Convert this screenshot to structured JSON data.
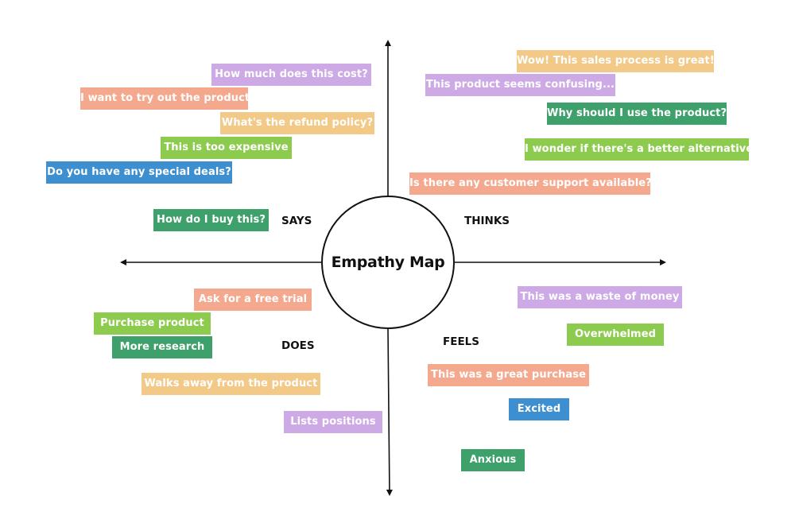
{
  "title": "Empathy Map",
  "colors": {
    "purple": "#CDA9E6",
    "salmon": "#F4A98F",
    "orange": "#F2C987",
    "green": "#8DCB4F",
    "dark_green": "#3EA06B",
    "blue": "#3D8FCF",
    "line": "#111111"
  },
  "quadrants": {
    "says": {
      "label": "SAYS",
      "notes": [
        {
          "text": "How much does this cost?",
          "color": "purple"
        },
        {
          "text": "I want to try out the product",
          "color": "salmon"
        },
        {
          "text": "What's the refund policy?",
          "color": "orange"
        },
        {
          "text": "This is too expensive",
          "color": "green"
        },
        {
          "text": "Do you have any special deals?",
          "color": "blue"
        },
        {
          "text": "How do I buy this?",
          "color": "dark_green"
        }
      ]
    },
    "thinks": {
      "label": "THINKS",
      "notes": [
        {
          "text": "Wow! This sales process is great!",
          "color": "orange"
        },
        {
          "text": "This product seems confusing...",
          "color": "purple"
        },
        {
          "text": "Why should I use the product?",
          "color": "dark_green"
        },
        {
          "text": "I wonder if there's a better alternative",
          "color": "green"
        },
        {
          "text": "Is there any customer support available?",
          "color": "salmon"
        }
      ]
    },
    "does": {
      "label": "DOES",
      "notes": [
        {
          "text": "Ask for a free trial",
          "color": "salmon"
        },
        {
          "text": "Purchase product",
          "color": "green"
        },
        {
          "text": "More research",
          "color": "dark_green"
        },
        {
          "text": "Walks away from the product",
          "color": "orange"
        },
        {
          "text": "Lists positions",
          "color": "purple"
        }
      ]
    },
    "feels": {
      "label": "FEELS",
      "notes": [
        {
          "text": "This was a waste of money",
          "color": "purple"
        },
        {
          "text": "Overwhelmed",
          "color": "green"
        },
        {
          "text": "This was a great purchase",
          "color": "salmon"
        },
        {
          "text": "Excited",
          "color": "blue"
        },
        {
          "text": "Anxious",
          "color": "dark_green"
        }
      ]
    }
  }
}
